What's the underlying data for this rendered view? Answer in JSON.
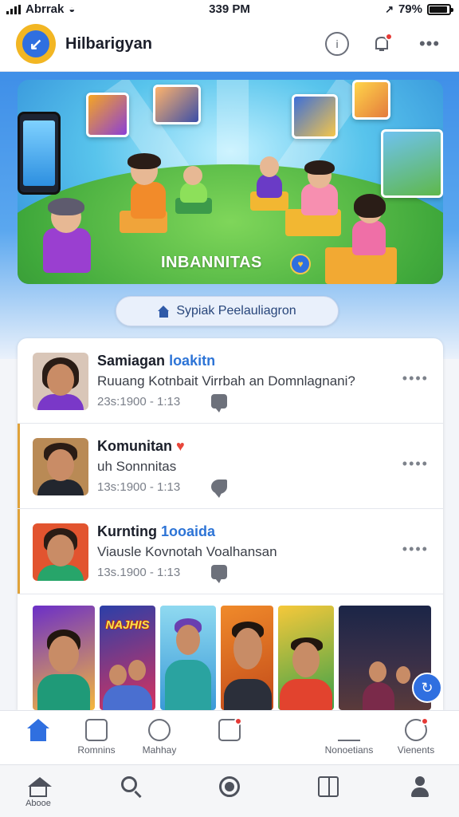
{
  "status_bar": {
    "carrier": "Abrrak",
    "time": "339 PM",
    "battery": "79%"
  },
  "header": {
    "app_name": "Hilbarigyan"
  },
  "banner": {
    "title": "INBANNITAS"
  },
  "pill_button": {
    "label": "Sypiak Peelauliagron"
  },
  "posts": [
    {
      "name": "Samiagan",
      "tag": "loakitn",
      "text": "Ruuang Kotnbait Virrbah an Domnlagnani?",
      "meta": "23s:1900 - 1:13"
    },
    {
      "name": "Komunitan",
      "tag": "",
      "text": "uh Sonnnitas",
      "meta": "13s:1900 - 1:13"
    },
    {
      "name": "Kurnting",
      "tag": "1ooaida",
      "text": "Viausle Kovnotah Voalhansan",
      "meta": "13s.1900 - 1:13"
    }
  ],
  "gallery": [
    {
      "title": ""
    },
    {
      "title": "NAJHIS"
    },
    {
      "title": ""
    },
    {
      "title": ""
    },
    {
      "title": ""
    },
    {
      "title": ""
    }
  ],
  "sub_tabs": [
    {
      "label": ""
    },
    {
      "label": "Romnins"
    },
    {
      "label": "Mahhay"
    },
    {
      "label": ""
    },
    {
      "label": "Nonoetians"
    },
    {
      "label": "Vienents"
    }
  ],
  "nav": {
    "home_label": "Abooe"
  },
  "colors": {
    "brand": "#2f6fe0",
    "accent_red": "#e53935",
    "logo_yellow": "#f2b623"
  }
}
